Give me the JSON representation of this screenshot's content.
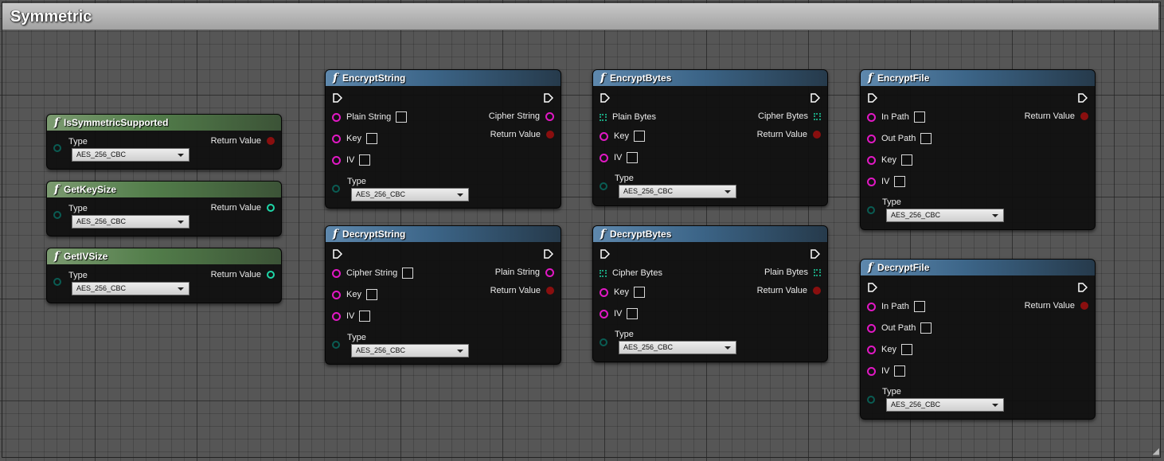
{
  "comment": {
    "title": "Symmetric"
  },
  "enum_default": "AES_256_CBC",
  "colors": {
    "pure_header": "#527d4a",
    "impure_header": "#3c6588",
    "string_pin": "#e118c4",
    "bool_pin": "#8a0f0f",
    "int_pin": "#1ed7a8",
    "enum_pin": "#0a5c53",
    "bytes_pin": "#1aa37e"
  },
  "nodes": {
    "is_symmetric_supported": {
      "title": "IsSymmetricSupported",
      "type_label": "Type",
      "type_value": "AES_256_CBC",
      "return_label": "Return Value"
    },
    "get_key_size": {
      "title": "GetKeySize",
      "type_label": "Type",
      "type_value": "AES_256_CBC",
      "return_label": "Return Value"
    },
    "get_iv_size": {
      "title": "GetIVSize",
      "type_label": "Type",
      "type_value": "AES_256_CBC",
      "return_label": "Return Value"
    },
    "encrypt_string": {
      "title": "EncryptString",
      "in1": "Plain String",
      "key": "Key",
      "iv": "IV",
      "type_label": "Type",
      "type_value": "AES_256_CBC",
      "out1": "Cipher String",
      "return_label": "Return Value"
    },
    "decrypt_string": {
      "title": "DecryptString",
      "in1": "Cipher String",
      "key": "Key",
      "iv": "IV",
      "type_label": "Type",
      "type_value": "AES_256_CBC",
      "out1": "Plain String",
      "return_label": "Return Value"
    },
    "encrypt_bytes": {
      "title": "EncryptBytes",
      "in1": "Plain Bytes",
      "key": "Key",
      "iv": "IV",
      "type_label": "Type",
      "type_value": "AES_256_CBC",
      "out1": "Cipher Bytes",
      "return_label": "Return Value"
    },
    "decrypt_bytes": {
      "title": "DecryptBytes",
      "in1": "Cipher Bytes",
      "key": "Key",
      "iv": "IV",
      "type_label": "Type",
      "type_value": "AES_256_CBC",
      "out1": "Plain Bytes",
      "return_label": "Return Value"
    },
    "encrypt_file": {
      "title": "EncryptFile",
      "in_path": "In Path",
      "out_path": "Out Path",
      "key": "Key",
      "iv": "IV",
      "type_label": "Type",
      "type_value": "AES_256_CBC",
      "return_label": "Return Value"
    },
    "decrypt_file": {
      "title": "DecryptFile",
      "in_path": "In Path",
      "out_path": "Out Path",
      "key": "Key",
      "iv": "IV",
      "type_label": "Type",
      "type_value": "AES_256_CBC",
      "return_label": "Return Value"
    }
  }
}
